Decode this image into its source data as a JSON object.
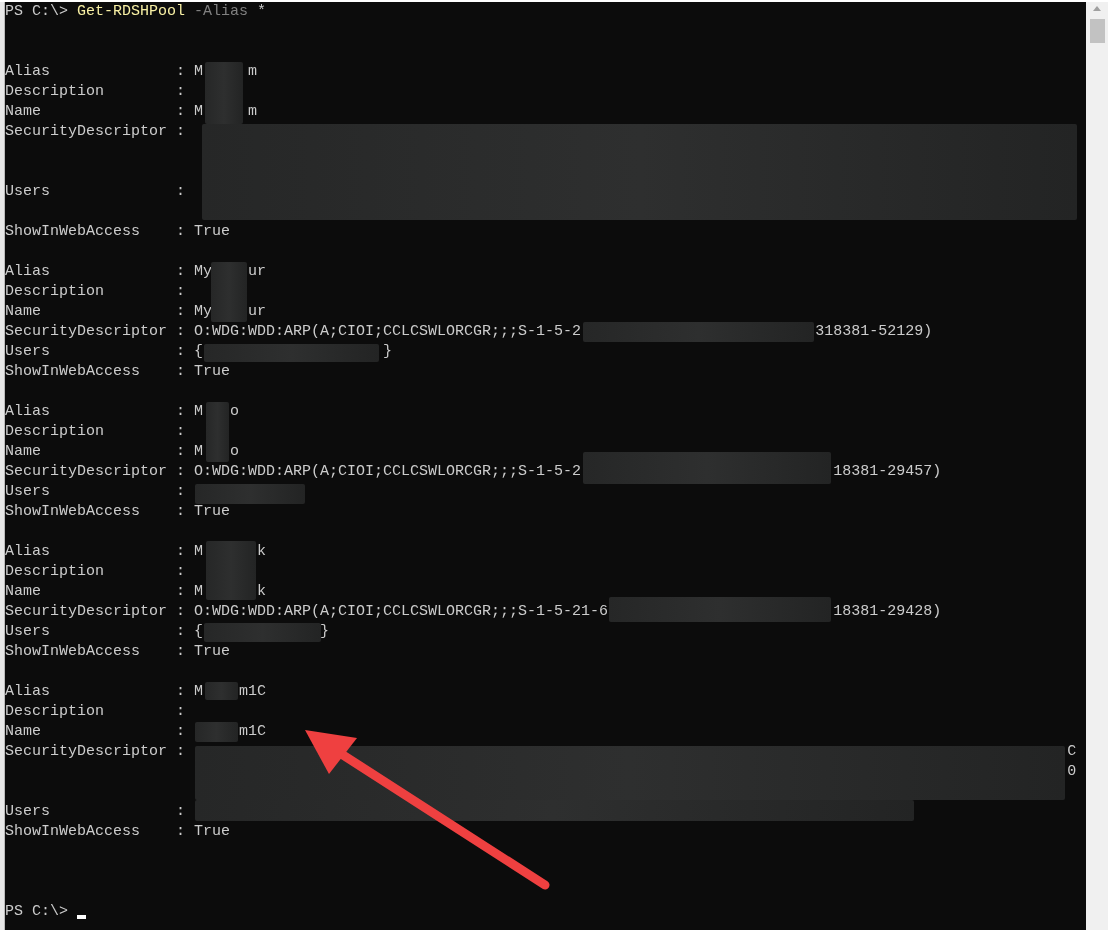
{
  "command_line": {
    "prompt": "PS C:\\>",
    "command": "Get-RDSHPool",
    "parameter": "-Alias",
    "argument": "*"
  },
  "records": [
    {
      "fields": [
        {
          "label": "Alias",
          "colon": ":",
          "parts": [
            "M",
            "m"
          ]
        },
        {
          "label": "Description",
          "colon": ":"
        },
        {
          "label": "Name",
          "colon": ":",
          "parts": [
            "M",
            "m"
          ]
        },
        {
          "label": "SecurityDescriptor",
          "colon": ":"
        },
        {
          "label": "Users",
          "colon": ":"
        },
        {
          "label": "ShowInWebAccess",
          "colon": ":",
          "parts": [
            "True"
          ]
        }
      ]
    },
    {
      "fields": [
        {
          "label": "Alias",
          "colon": ":",
          "parts": [
            "My",
            "ur"
          ]
        },
        {
          "label": "Description",
          "colon": ":"
        },
        {
          "label": "Name",
          "colon": ":",
          "parts": [
            "My",
            "ur"
          ]
        },
        {
          "label": "SecurityDescriptor",
          "colon": ":",
          "parts": [
            "O:WDG:WDD:ARP(A;CIOI;CCLCSWLORCGR;;;S-1-5-2",
            "318381-52129)"
          ]
        },
        {
          "label": "Users",
          "colon": ":",
          "parts": [
            "{",
            "}"
          ]
        },
        {
          "label": "ShowInWebAccess",
          "colon": ":",
          "parts": [
            "True"
          ]
        }
      ]
    },
    {
      "fields": [
        {
          "label": "Alias",
          "colon": ":",
          "parts": [
            "M",
            "o"
          ]
        },
        {
          "label": "Description",
          "colon": ":"
        },
        {
          "label": "Name",
          "colon": ":",
          "parts": [
            "M",
            "o"
          ]
        },
        {
          "label": "SecurityDescriptor",
          "colon": ":",
          "parts": [
            "O:WDG:WDD:ARP(A;CIOI;CCLCSWLORCGR;;;S-1-5-2",
            "18381-29457)"
          ]
        },
        {
          "label": "Users",
          "colon": ":"
        },
        {
          "label": "ShowInWebAccess",
          "colon": ":",
          "parts": [
            "True"
          ]
        }
      ]
    },
    {
      "fields": [
        {
          "label": "Alias",
          "colon": ":",
          "parts": [
            "M",
            "k"
          ]
        },
        {
          "label": "Description",
          "colon": ":"
        },
        {
          "label": "Name",
          "colon": ":",
          "parts": [
            "M",
            "k"
          ]
        },
        {
          "label": "SecurityDescriptor",
          "colon": ":",
          "parts": [
            "O:WDG:WDD:ARP(A;CIOI;CCLCSWLORCGR;;;S-1-5-21-6",
            "18381-29428)"
          ]
        },
        {
          "label": "Users",
          "colon": ":",
          "parts": [
            "{",
            "}"
          ]
        },
        {
          "label": "ShowInWebAccess",
          "colon": ":",
          "parts": [
            "True"
          ]
        }
      ]
    },
    {
      "fields": [
        {
          "label": "Alias",
          "colon": ":",
          "parts": [
            "M",
            "m1C"
          ]
        },
        {
          "label": "Description",
          "colon": ":"
        },
        {
          "label": "Name",
          "colon": ":",
          "parts": [
            "m1C"
          ]
        },
        {
          "label": "SecurityDescriptor",
          "colon": ":",
          "parts": [
            "C"
          ]
        },
        {
          "parts": [
            "0"
          ]
        },
        {
          "label": "Users",
          "colon": ":"
        },
        {
          "label": "ShowInWebAccess",
          "colon": ":",
          "parts": [
            "True"
          ]
        }
      ]
    }
  ],
  "final_prompt": "PS C:\\>"
}
